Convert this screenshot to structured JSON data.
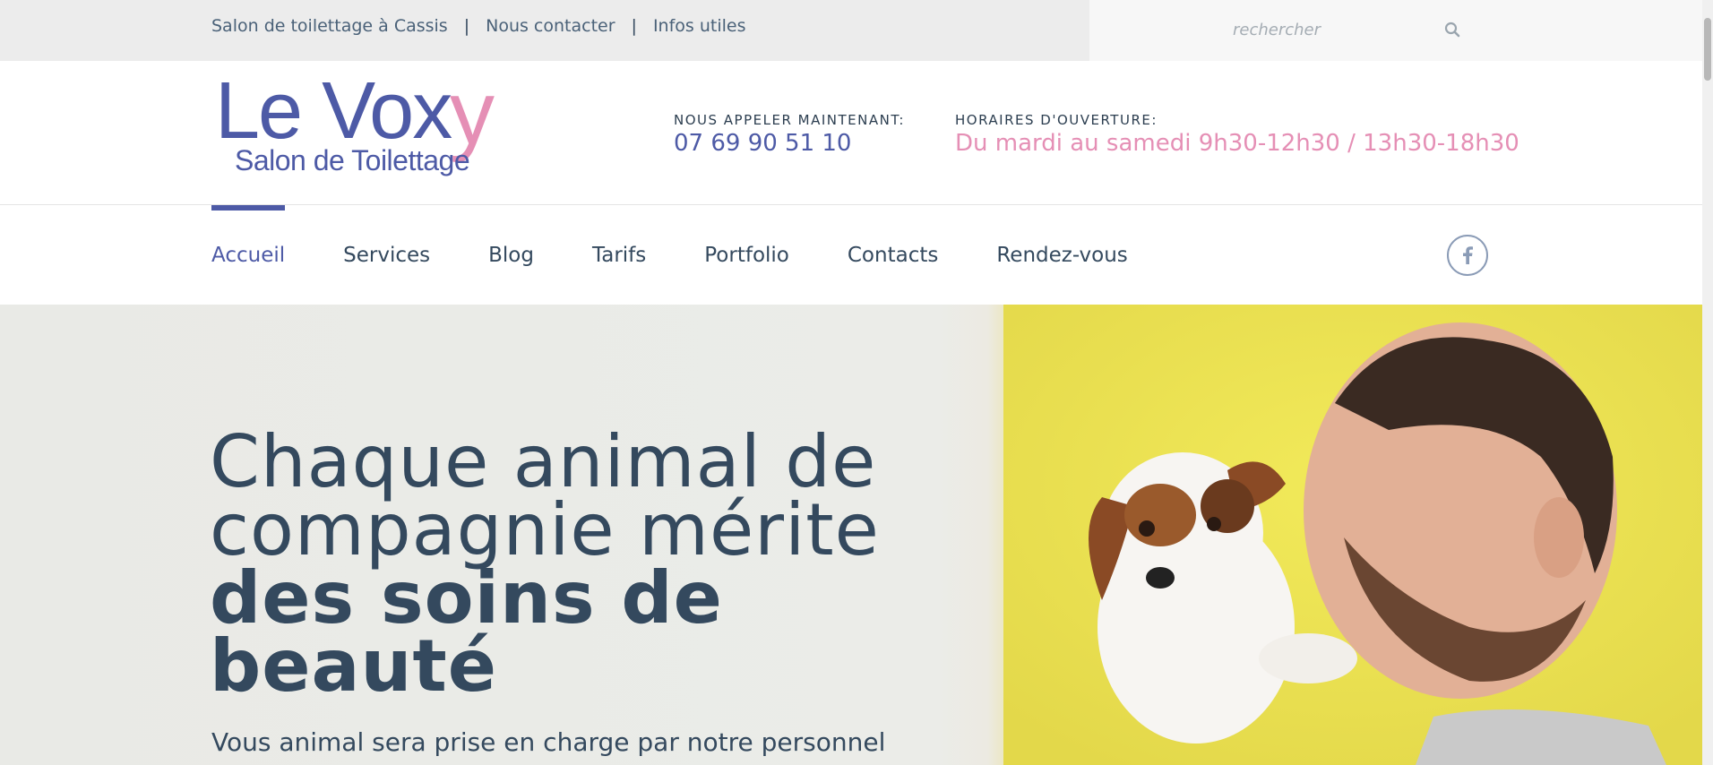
{
  "topbar": {
    "links": [
      "Salon de toilettage à Cassis",
      "Nous contacter",
      "Infos utiles"
    ],
    "separator": "|"
  },
  "search": {
    "placeholder": "rechercher",
    "icon": "search-icon"
  },
  "logo": {
    "main": "Le Vox",
    "accent_letter": "y",
    "tagline": "Salon de Toilettage",
    "colors": {
      "main": "#4d5aa6",
      "accent": "#e58fb5"
    }
  },
  "contact": {
    "label": "NOUS APPELER MAINTENANT:",
    "phone": "07 69 90 51 10"
  },
  "hours": {
    "label": "HORAIRES D'OUVERTURE:",
    "value": "Du mardi au samedi 9h30-12h30 / 13h30-18h30"
  },
  "nav": {
    "items": [
      "Accueil",
      "Services",
      "Blog",
      "Tarifs",
      "Portfolio",
      "Contacts",
      "Rendez-vous"
    ],
    "active": "Accueil",
    "social_icon": "facebook-icon"
  },
  "hero": {
    "title_line1": "Chaque animal de",
    "title_line2": "compagnie mérite",
    "title_bold1": "des soins de",
    "title_bold2": "beauté",
    "subtitle": "Vous animal sera prise en charge par notre personnel"
  },
  "colors": {
    "accent": "#4d5aa6",
    "pink": "#e58fb5",
    "text": "#34495e"
  }
}
